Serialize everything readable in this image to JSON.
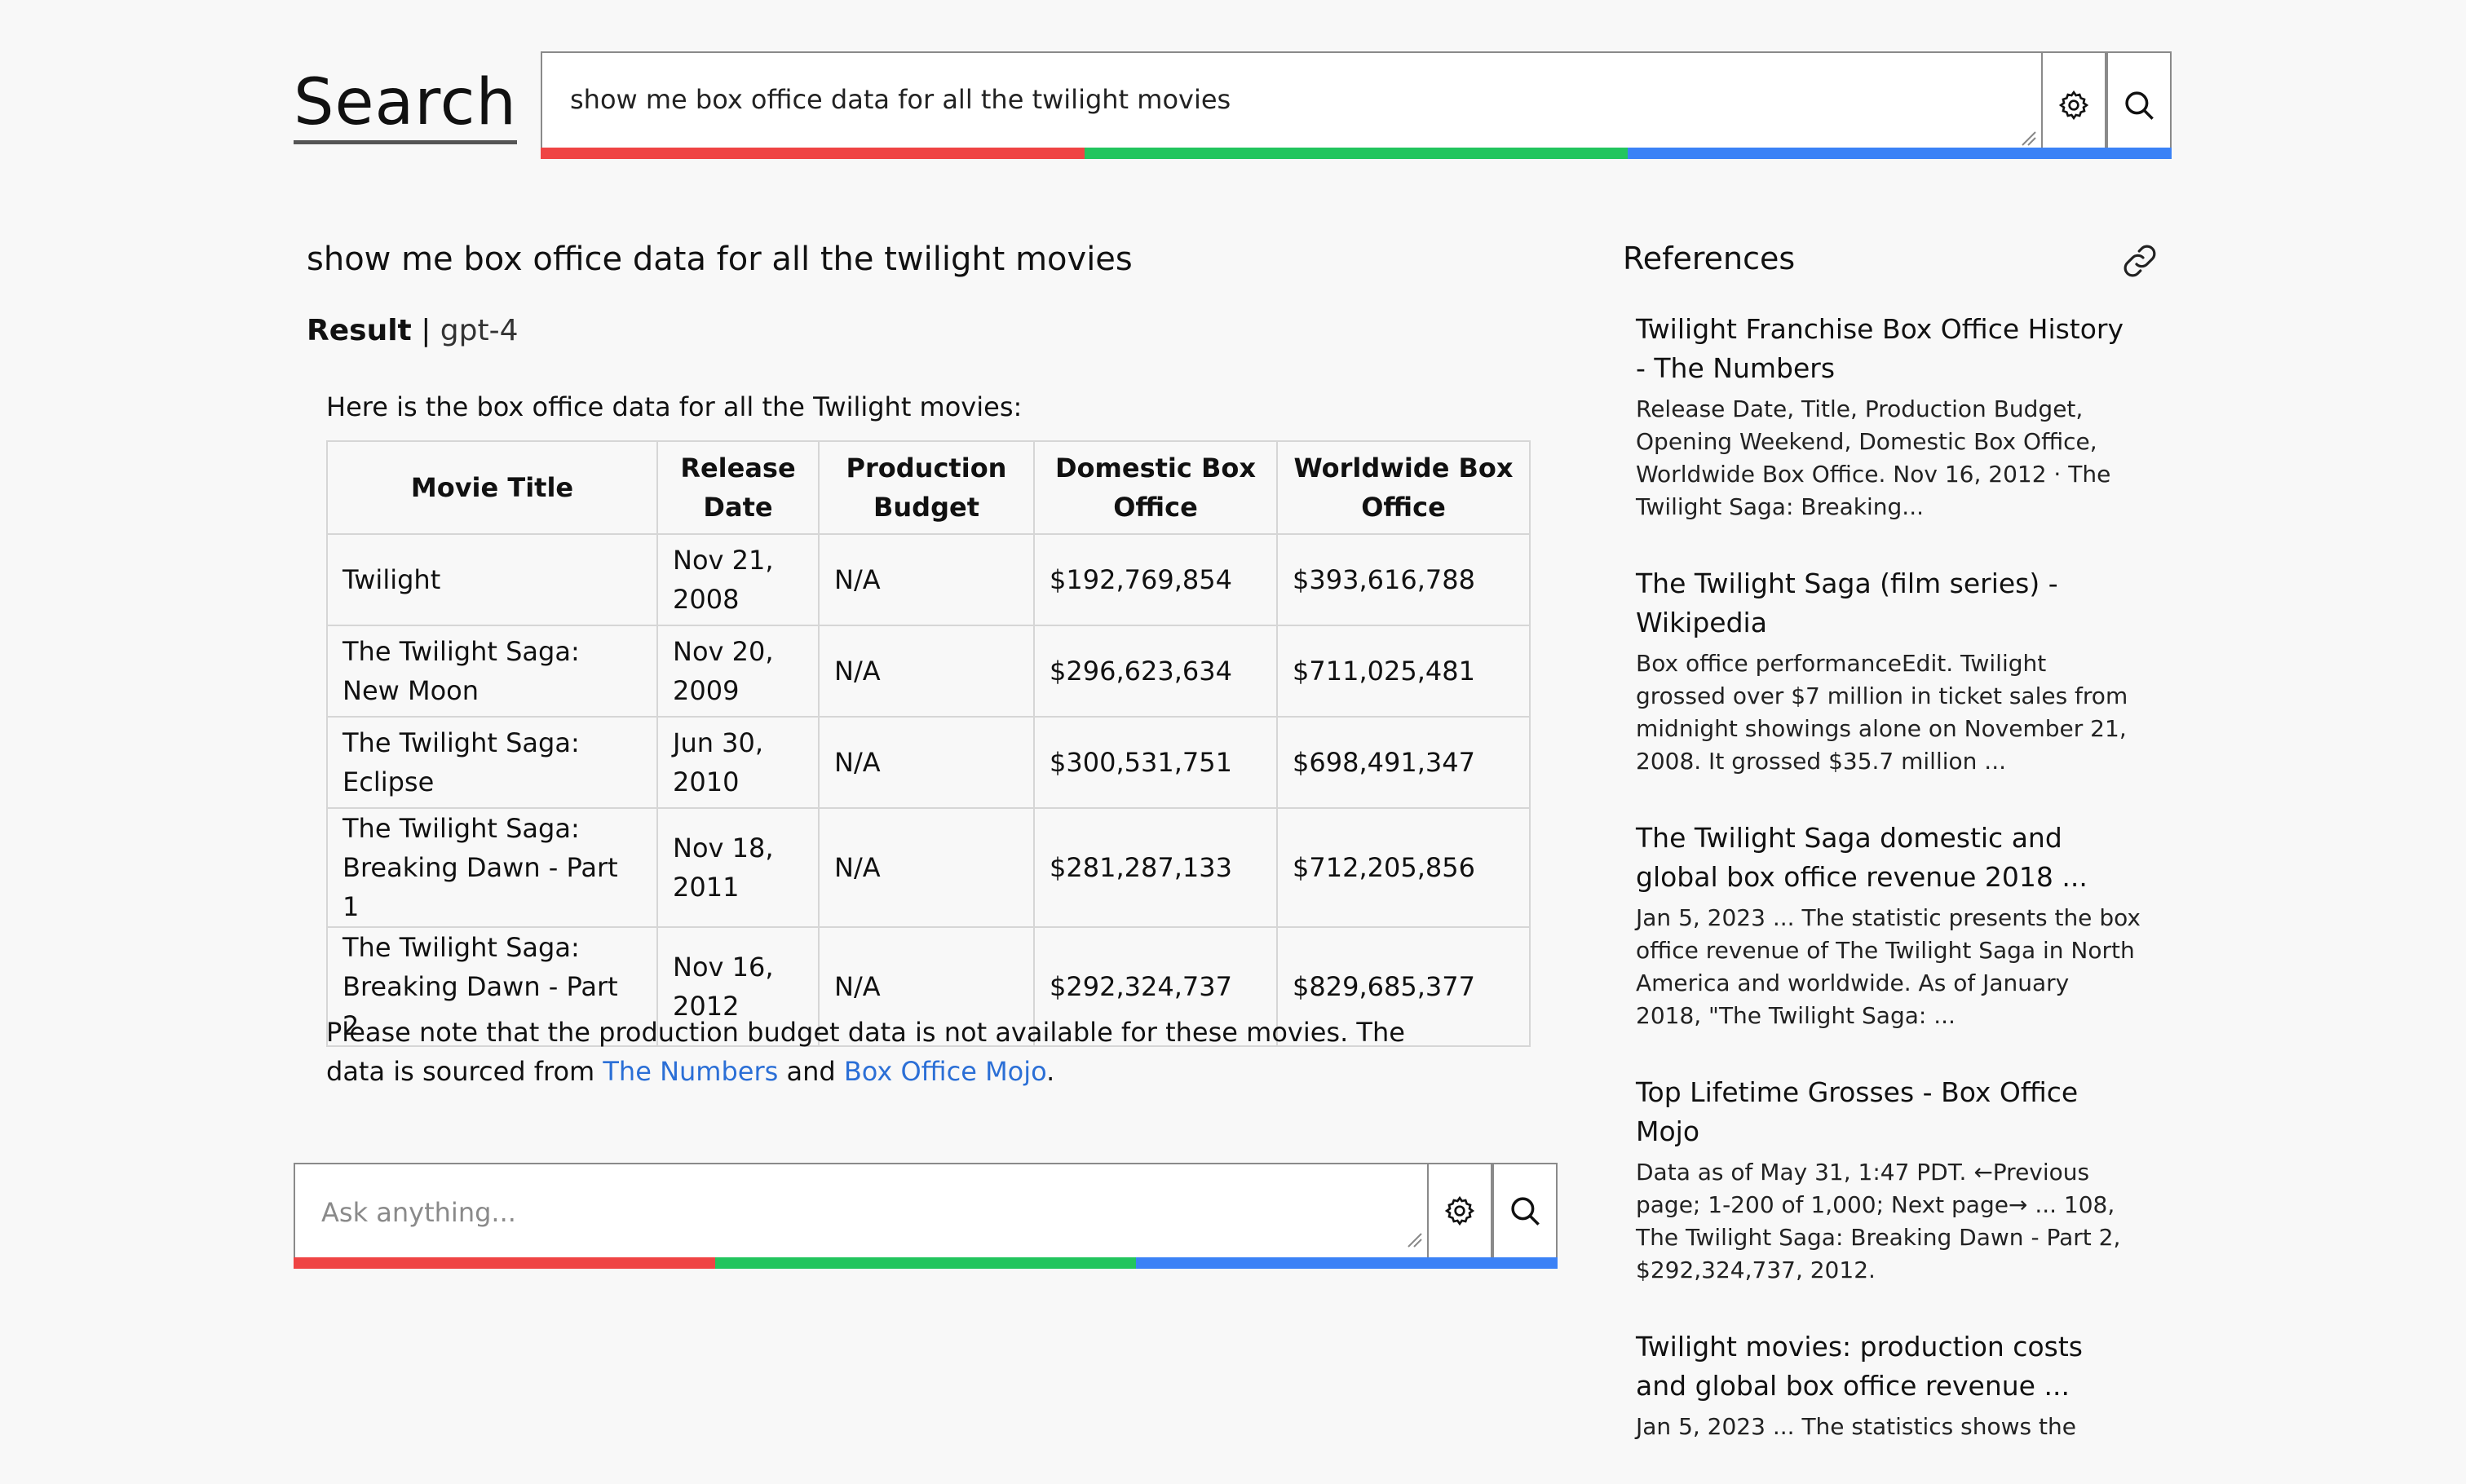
{
  "header": {
    "brand": "Search",
    "query": "show me box office data for all the twilight movies"
  },
  "main": {
    "question": "show me box office data for all the twilight movies",
    "result_label": "Result",
    "model": "gpt-4",
    "intro": "Here is the box office data for all the Twilight movies:",
    "table": {
      "headers": [
        "Movie Title",
        "Release Date",
        "Production Budget",
        "Domestic Box Office",
        "Worldwide Box Office"
      ],
      "rows": [
        [
          "Twilight",
          "Nov 21, 2008",
          "N/A",
          "$192,769,854",
          "$393,616,788"
        ],
        [
          "The Twilight Saga: New Moon",
          "Nov 20, 2009",
          "N/A",
          "$296,623,634",
          "$711,025,481"
        ],
        [
          "The Twilight Saga: Eclipse",
          "Jun 30, 2010",
          "N/A",
          "$300,531,751",
          "$698,491,347"
        ],
        [
          "The Twilight Saga: Breaking Dawn - Part 1",
          "Nov 18, 2011",
          "N/A",
          "$281,287,133",
          "$712,205,856"
        ],
        [
          "The Twilight Saga: Breaking Dawn - Part 2",
          "Nov 16, 2012",
          "N/A",
          "$292,324,737",
          "$829,685,377"
        ]
      ]
    },
    "note_before": "Please note that the production budget data is not available for these movies. The data is sourced from ",
    "link1": "The Numbers",
    "note_mid": " and ",
    "link2": "Box Office Mojo",
    "note_after": ".",
    "ask_placeholder": "Ask anything..."
  },
  "references": {
    "title": "References",
    "items": [
      {
        "title": "Twilight Franchise Box Office History - The Numbers",
        "snippet": "Release Date, Title, Production Budget, Opening Weekend, Domestic Box Office, Worldwide Box Office. Nov 16, 2012 · The Twilight Saga: Breaking..."
      },
      {
        "title": "The Twilight Saga (film series) - Wikipedia",
        "snippet": "Box office performanceEdit. Twilight grossed over $7 million in ticket sales from midnight showings alone on November 21, 2008. It grossed $35.7 million ..."
      },
      {
        "title": "The Twilight Saga domestic and global box office revenue 2018 ...",
        "snippet": "Jan 5, 2023 ... The statistic presents the box office revenue of The Twilight Saga in North America and worldwide. As of January 2018, \"The Twilight Saga: ..."
      },
      {
        "title": "Top Lifetime Grosses - Box Office Mojo",
        "snippet": "Data as of May 31, 1:47 PDT. ←Previous page; 1-200 of 1,000; Next page→ ... 108, The Twilight Saga: Breaking Dawn - Part 2, $292,324,737, 2012."
      },
      {
        "title": "Twilight movies: production costs and global box office revenue ...",
        "snippet": "Jan 5, 2023 ... The statistics shows the"
      }
    ]
  },
  "icons": {
    "settings": "gear-icon",
    "search": "search-icon",
    "link": "link-icon"
  },
  "colors": {
    "bar_red": "#ef4444",
    "bar_green": "#22c55e",
    "bar_blue": "#3b82f6",
    "link": "#2b6fd6"
  }
}
